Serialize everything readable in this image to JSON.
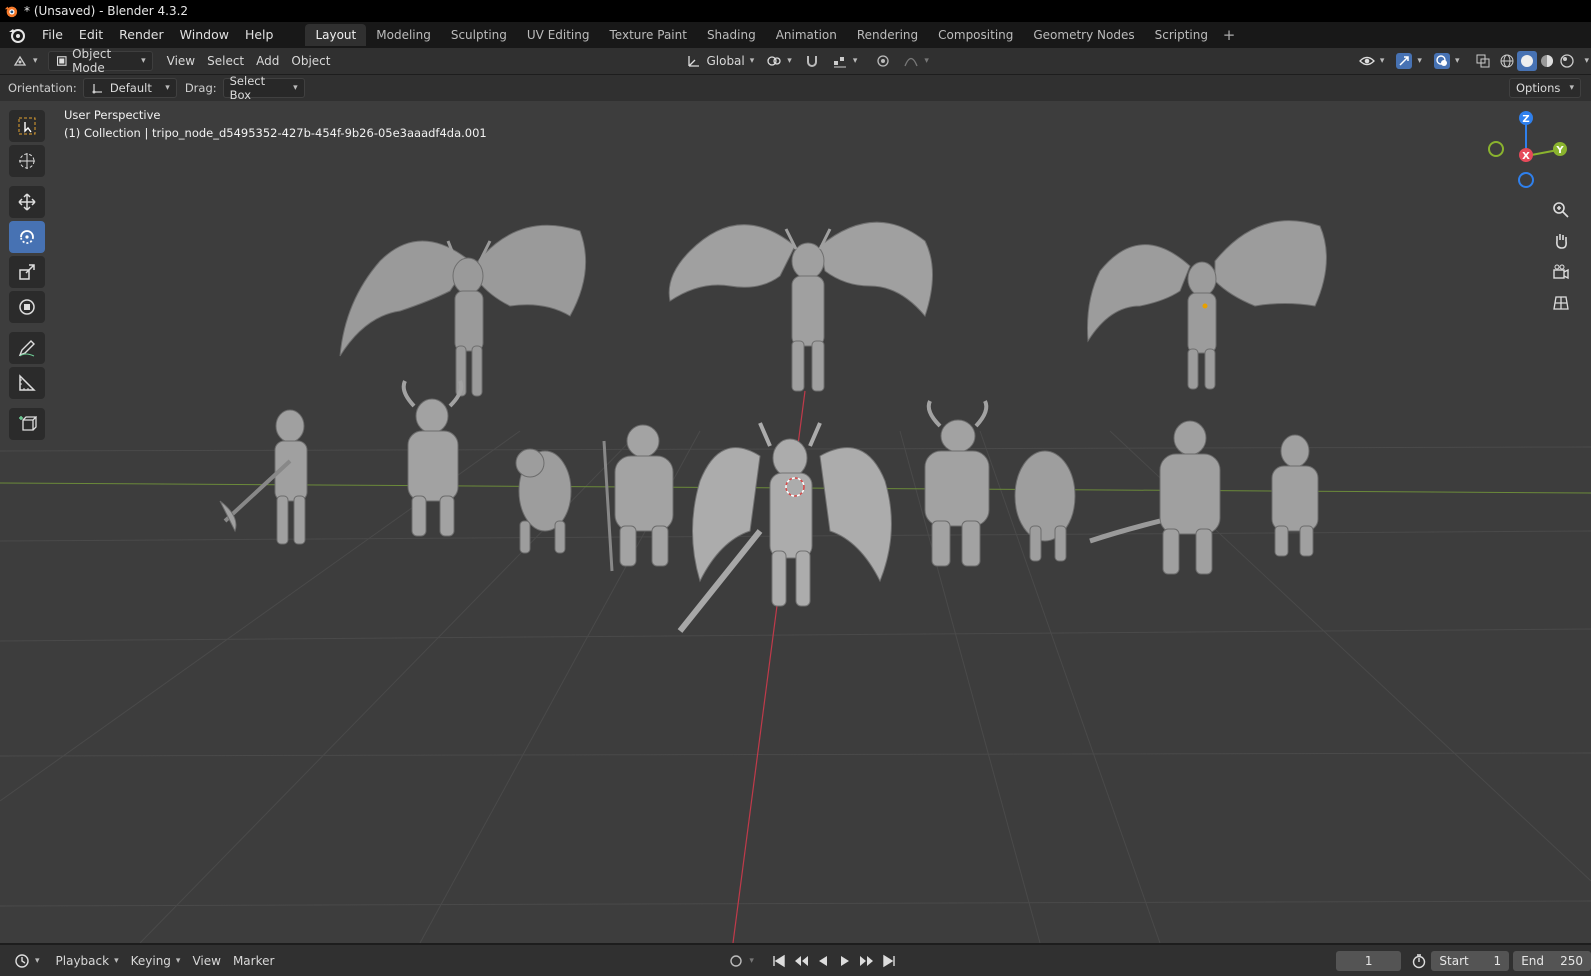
{
  "window": {
    "title": "* (Unsaved) - Blender 4.3.2"
  },
  "menu": {
    "items": [
      "File",
      "Edit",
      "Render",
      "Window",
      "Help"
    ]
  },
  "workspaces": {
    "tabs": [
      "Layout",
      "Modeling",
      "Sculpting",
      "UV Editing",
      "Texture Paint",
      "Shading",
      "Animation",
      "Rendering",
      "Compositing",
      "Geometry Nodes",
      "Scripting"
    ],
    "active": "Layout",
    "add_label": "+"
  },
  "header": {
    "mode": "Object Mode",
    "menus": [
      "View",
      "Select",
      "Add",
      "Object"
    ],
    "transform_orientation": "Global"
  },
  "tool_settings": {
    "orientation_label": "Orientation:",
    "orientation_value": "Default",
    "drag_label": "Drag:",
    "drag_value": "Select Box",
    "options_label": "Options"
  },
  "viewport": {
    "view_name": "User Perspective",
    "collection_info": "(1) Collection | tripo_node_d5495352-427b-454f-9b26-05e3aaadf4da.001",
    "gizmo_axes": {
      "z": "Z",
      "x": "X",
      "y": "Y"
    }
  },
  "timeline": {
    "menus": [
      "Playback",
      "Keying",
      "View",
      "Marker"
    ],
    "current_frame": "1",
    "start_label": "Start",
    "start_value": "1",
    "end_label": "End",
    "end_value": "250"
  },
  "colors": {
    "active_blue": "#4772b3",
    "axis_x": "#e64a5a",
    "axis_y": "#8ab32e",
    "axis_z": "#2f80ed",
    "viewport_bg": "#3d3d3d"
  }
}
